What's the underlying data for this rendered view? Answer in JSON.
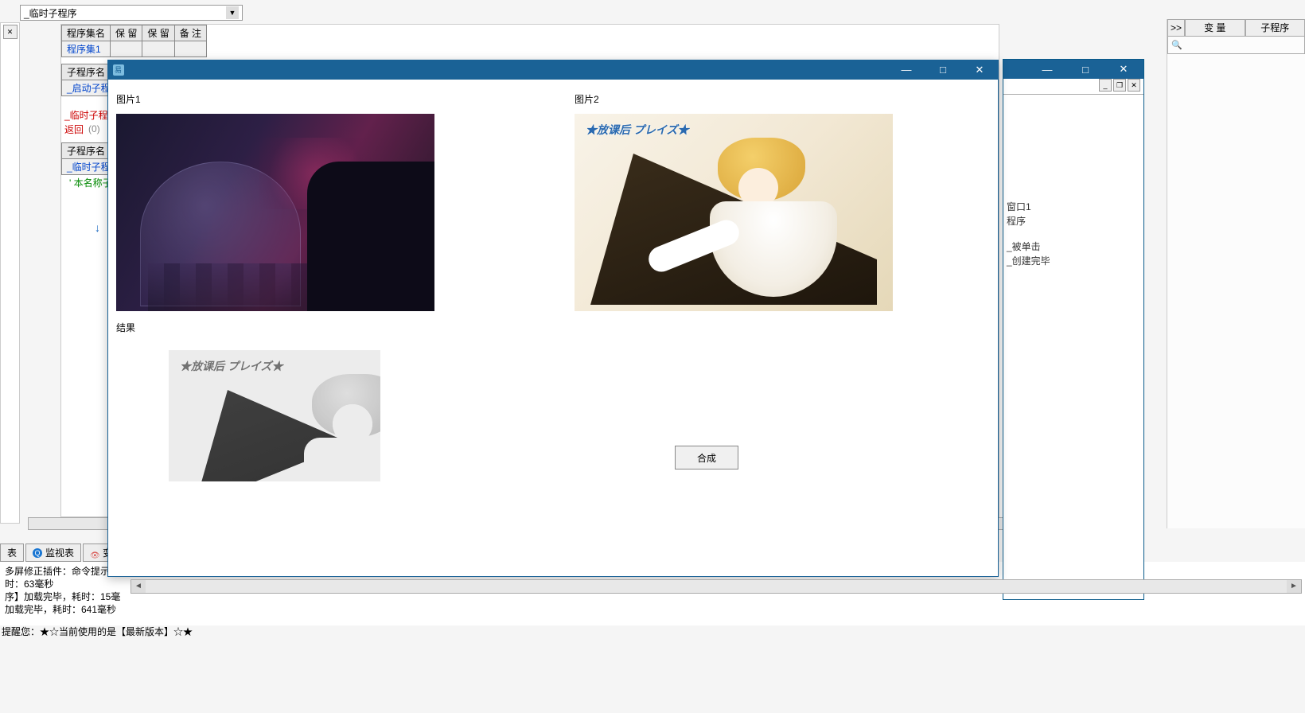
{
  "combo": {
    "value": "_临时子程序"
  },
  "table1": {
    "h1": "程序集名",
    "h2": "保  留",
    "h3": "保  留",
    "h4": "备 注",
    "r1": "程序集1"
  },
  "table2": {
    "h1": "子程序名",
    "r1": "_启动子程"
  },
  "code": {
    "line1": "_临时子程",
    "ret": "返回",
    "ret_v": "(0)"
  },
  "table3": {
    "h1": "子程序名",
    "r1": "_临时子程序"
  },
  "comment": "'  本名称子租",
  "right_panel": {
    "ghost": ">>",
    "tab1": "变  量",
    "tab2": "子程序",
    "search_icon": "🔍"
  },
  "blue_win": {
    "tree1": "窗口1",
    "tree2": "程序",
    "tree3": "_被单击",
    "tree4": "_创建完毕"
  },
  "win": {
    "img1_label": "图片1",
    "img2_label": "图片2",
    "img2_logo": "★放课后 プレイズ★",
    "result_label": "结果",
    "btn": "合成",
    "min": "—",
    "max": "□",
    "close": "✕"
  },
  "bottom_tabs": {
    "t1": "表",
    "t2": "监视表",
    "t3": "变量表"
  },
  "log": {
    "l1": "多屏修正插件：命令提示",
    "l2": "时：63毫秒",
    "l3": "序】加载完毕，耗时：15毫",
    "l4": "加载完毕，耗时：641毫秒"
  },
  "status": "提醒您：★☆当前使用的是【最新版本】☆★"
}
